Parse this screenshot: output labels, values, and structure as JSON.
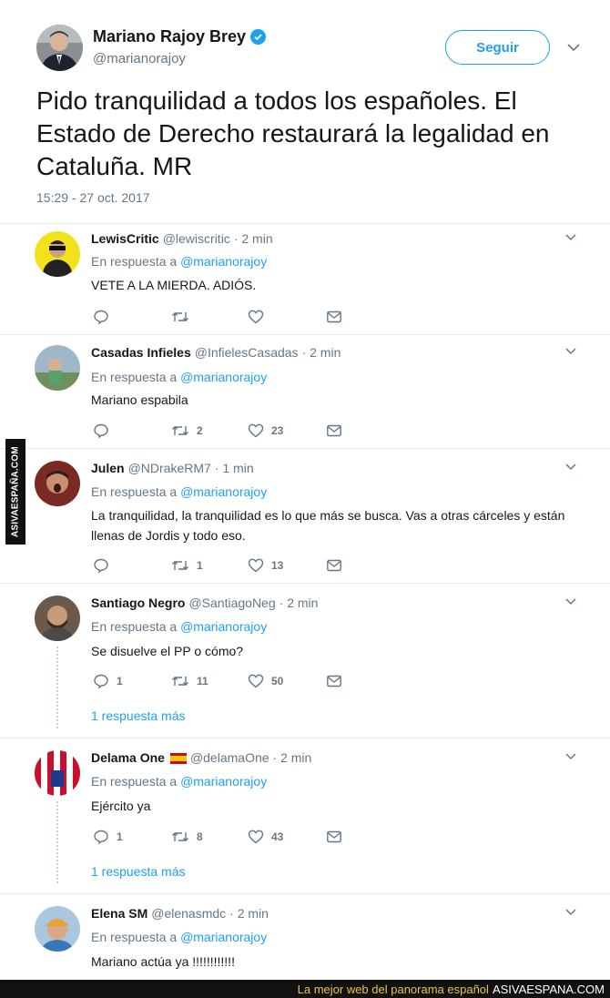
{
  "main_tweet": {
    "name": "Mariano Rajoy Brey",
    "handle": "@marianorajoy",
    "follow_label": "Seguir",
    "text": "Pido tranquilidad a todos los españoles. El Estado de Derecho restaurará la legalidad en Cataluña. MR",
    "timestamp": "15:29 - 27 oct. 2017",
    "verified_icon": "verified-badge-icon",
    "accent": "#1da1f2"
  },
  "reply_prefix": "En respuesta a",
  "reply_mention": "@marianorajoy",
  "replies": [
    {
      "name": "LewisCritic",
      "handle": "@lewiscritic",
      "time": "· 2 min",
      "text": "VETE A LA MIERDA. ADIÓS.",
      "replies_count": "",
      "retweets_count": "",
      "likes_count": ""
    },
    {
      "name": "Casadas Infieles",
      "handle": "@InfielesCasadas",
      "time": "· 2 min",
      "text": "Mariano espabila",
      "replies_count": "",
      "retweets_count": "2",
      "likes_count": "23"
    },
    {
      "name": "Julen",
      "handle": "@NDrakeRM7",
      "time": "· 1 min",
      "text": "La tranquilidad, la tranquilidad es lo que más se busca. Vas a otras cárceles y están llenas de Jordis y todo eso.",
      "replies_count": "",
      "retweets_count": "1",
      "likes_count": "13"
    },
    {
      "name": "Santiago Negro",
      "handle": "@SantiagoNeg",
      "time": "· 2 min",
      "text": "Se disuelve el PP o cómo?",
      "replies_count": "1",
      "retweets_count": "11",
      "likes_count": "50",
      "more_replies": "1 respuesta más"
    },
    {
      "name": "Delama One",
      "handle": "@delamaOne",
      "time": "· 2 min",
      "text": "Ejército ya",
      "replies_count": "1",
      "retweets_count": "8",
      "likes_count": "43",
      "more_replies": "1 respuesta más"
    },
    {
      "name": "Elena SM",
      "handle": "@elenasmdc",
      "time": "· 2 min",
      "text": "Mariano actúa ya !!!!!!!!!!!!"
    }
  ],
  "watermark_side": "ASIVAESPAÑA.COM",
  "bottom_banner": {
    "tagline": "La mejor web del panorama español",
    "site": "ASIVAESPANA.COM"
  }
}
